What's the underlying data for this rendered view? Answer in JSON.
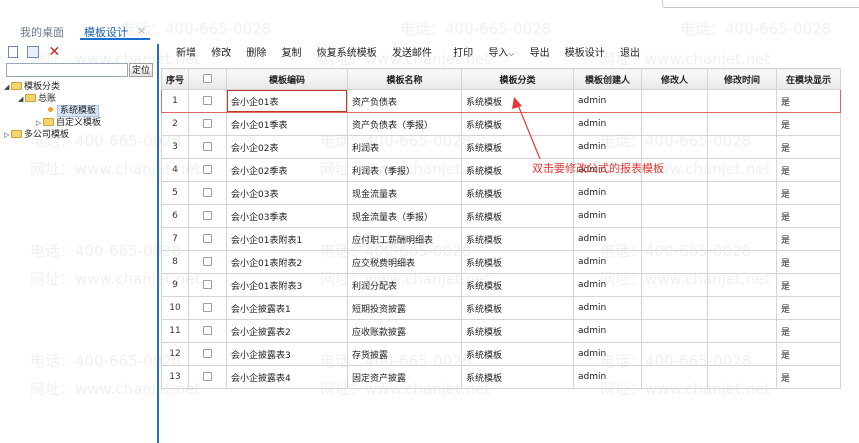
{
  "tabs": [
    {
      "label": "我的桌面"
    },
    {
      "label": "模板设计"
    }
  ],
  "tab_close": "×",
  "left": {
    "locate_label": "定位",
    "tree": {
      "root": "模板分类",
      "total": "总账",
      "system": "系统模板",
      "custom": "自定义模板",
      "multi": "多公司模板"
    }
  },
  "toolbar": {
    "add": "新增",
    "edit": "修改",
    "delete": "删除",
    "copy": "复制",
    "restore": "恢复系统模板",
    "mail": "发送邮件",
    "print": "打印",
    "import": "导入",
    "export": "导出",
    "design": "模板设计",
    "exit": "退出"
  },
  "grid": {
    "headers": {
      "seq": "序号",
      "code": "模板编码",
      "name": "模板名称",
      "category": "模板分类",
      "creator": "模板创建人",
      "modifier": "修改人",
      "mtime": "修改时间",
      "show": "在模块显示"
    },
    "rows": [
      {
        "seq": "1",
        "code": "会小企01表",
        "name": "资产负债表",
        "category": "系统模板",
        "creator": "admin",
        "modifier": "",
        "mtime": "",
        "show": "是"
      },
      {
        "seq": "2",
        "code": "会小企01季表",
        "name": "资产负债表（季报）",
        "category": "系统模板",
        "creator": "admin",
        "modifier": "",
        "mtime": "",
        "show": "是"
      },
      {
        "seq": "3",
        "code": "会小企02表",
        "name": "利润表",
        "category": "系统模板",
        "creator": "admin",
        "modifier": "",
        "mtime": "",
        "show": "是"
      },
      {
        "seq": "4",
        "code": "会小企02季表",
        "name": "利润表（季报）",
        "category": "系统模板",
        "creator": "admin",
        "modifier": "",
        "mtime": "",
        "show": "是"
      },
      {
        "seq": "5",
        "code": "会小企03表",
        "name": "现金流量表",
        "category": "系统模板",
        "creator": "admin",
        "modifier": "",
        "mtime": "",
        "show": "是"
      },
      {
        "seq": "6",
        "code": "会小企03季表",
        "name": "现金流量表（季报）",
        "category": "系统模板",
        "creator": "admin",
        "modifier": "",
        "mtime": "",
        "show": "是"
      },
      {
        "seq": "7",
        "code": "会小企01表附表1",
        "name": "应付职工薪酬明细表",
        "category": "系统模板",
        "creator": "admin",
        "modifier": "",
        "mtime": "",
        "show": "是"
      },
      {
        "seq": "8",
        "code": "会小企01表附表2",
        "name": "应交税费明细表",
        "category": "系统模板",
        "creator": "admin",
        "modifier": "",
        "mtime": "",
        "show": "是"
      },
      {
        "seq": "9",
        "code": "会小企01表附表3",
        "name": "利润分配表",
        "category": "系统模板",
        "creator": "admin",
        "modifier": "",
        "mtime": "",
        "show": "是"
      },
      {
        "seq": "10",
        "code": "会小企披露表1",
        "name": "短期投资披露",
        "category": "系统模板",
        "creator": "admin",
        "modifier": "",
        "mtime": "",
        "show": "是"
      },
      {
        "seq": "11",
        "code": "会小企披露表2",
        "name": "应收账款披露",
        "category": "系统模板",
        "creator": "admin",
        "modifier": "",
        "mtime": "",
        "show": "是"
      },
      {
        "seq": "12",
        "code": "会小企披露表3",
        "name": "存货披露",
        "category": "系统模板",
        "creator": "admin",
        "modifier": "",
        "mtime": "",
        "show": "是"
      },
      {
        "seq": "13",
        "code": "会小企披露表4",
        "name": "固定资产披露",
        "category": "系统模板",
        "creator": "admin",
        "modifier": "",
        "mtime": "",
        "show": "是"
      }
    ]
  },
  "annotation": "双击要修改公式的报表模板",
  "watermark": {
    "phone": "电话：400-665-0028",
    "site": "网址：www.chanjet.net"
  },
  "colors": {
    "accent": "#1a6fd4",
    "annotation": "#e53935",
    "selected_border": "#e06666"
  }
}
